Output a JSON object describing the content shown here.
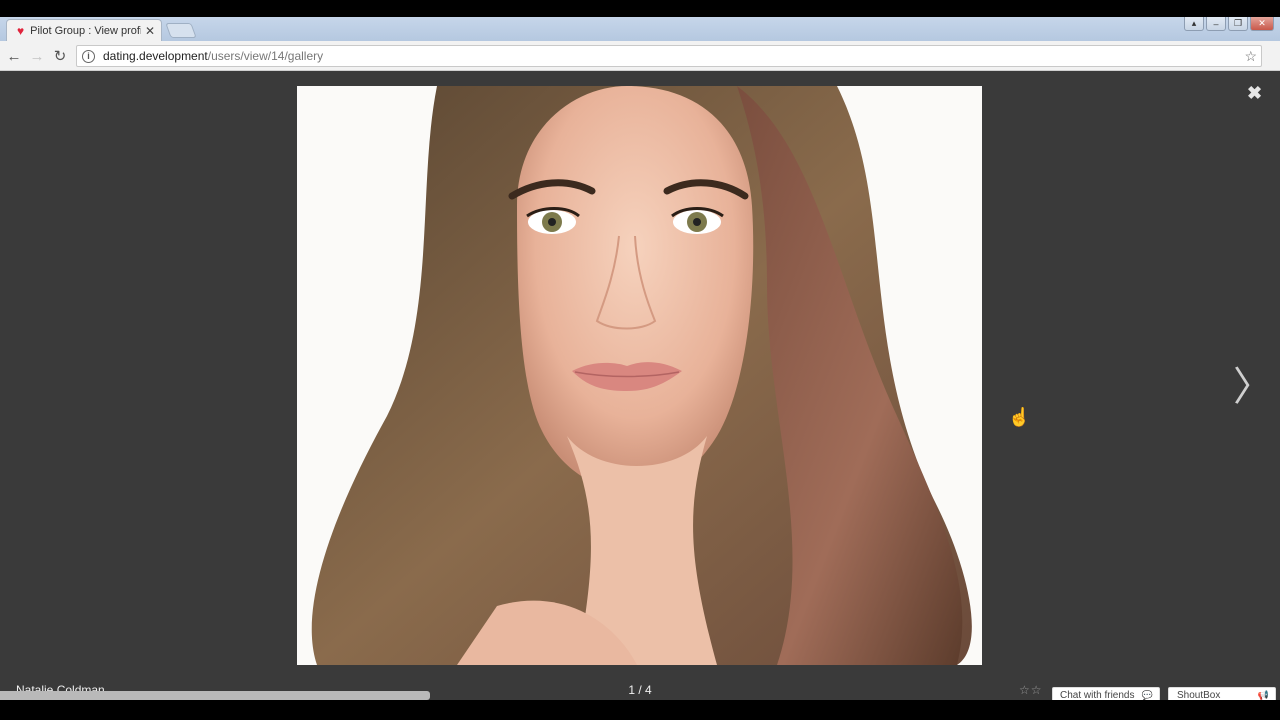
{
  "tab": {
    "title": "Pilot Group : View profile",
    "favicon": "heart-icon",
    "favicon_color": "#e0243c"
  },
  "address": {
    "host": "dating.development",
    "path": "/users/view/14/gallery"
  },
  "window": {
    "minimize": "‒",
    "restore": "❐",
    "close": "✕"
  },
  "viewer": {
    "owner_name": "Natalie Coldman",
    "counter": "1 / 4",
    "rating_stars": "☆☆"
  },
  "chat": {
    "label": "Chat with friends",
    "icon": "chat-bubble-icon"
  },
  "shoutbox": {
    "label": "ShoutBox",
    "icon": "megaphone-icon"
  },
  "colors": {
    "viewer_bg": "#3a3a3a",
    "accent": "#e0243c"
  }
}
